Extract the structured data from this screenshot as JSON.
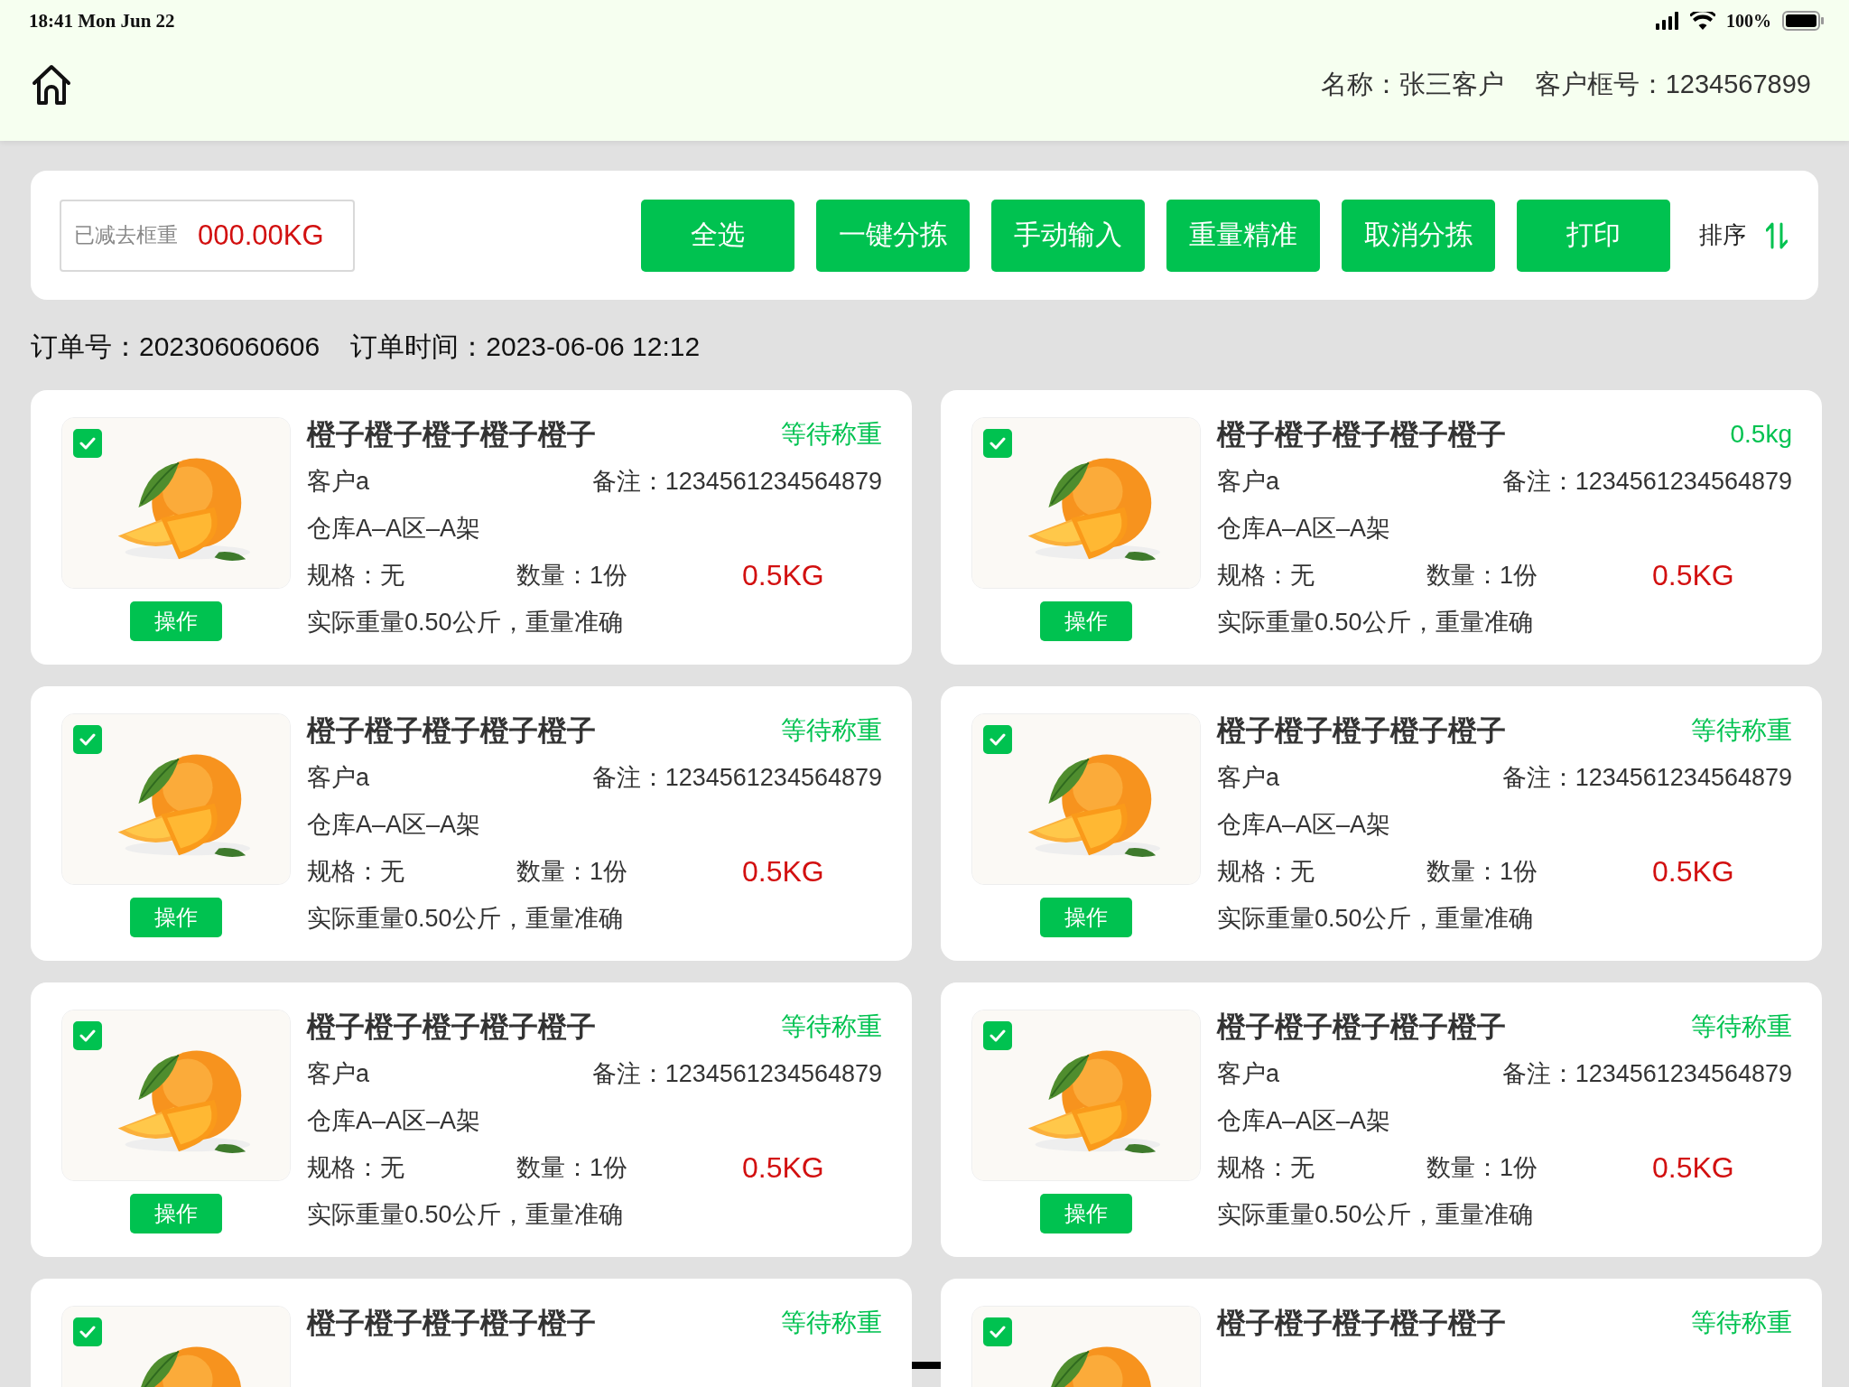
{
  "status_bar": {
    "time": "18:41 Mon Jun 22",
    "battery": "100%"
  },
  "header": {
    "name": "名称：张三客户",
    "box_no": "客户框号：1234567899"
  },
  "toolbar": {
    "tare_label": "已减去框重",
    "tare_value": "000.00KG",
    "buttons": [
      "全选",
      "一键分拣",
      "手动输入",
      "重量精准",
      "取消分拣",
      "打印"
    ],
    "sort_label": "排序"
  },
  "order": {
    "number": "订单号：202306060606",
    "time": "订单时间：2023-06-06 12:12"
  },
  "cards": [
    {
      "checked": true,
      "title": "橙子橙子橙子橙子橙子",
      "status": "等待称重",
      "customer": "客户a",
      "note": "备注：1234561234564879",
      "location": "仓库A–A区–A架",
      "spec": "规格：无",
      "qty": "数量：1份",
      "weight": "0.5KG",
      "actual": "实际重量0.50公斤，重量准确",
      "action": "操作"
    },
    {
      "checked": true,
      "title": "橙子橙子橙子橙子橙子",
      "status": "0.5kg",
      "customer": "客户a",
      "note": "备注：1234561234564879",
      "location": "仓库A–A区–A架",
      "spec": "规格：无",
      "qty": "数量：1份",
      "weight": "0.5KG",
      "actual": "实际重量0.50公斤，重量准确",
      "action": "操作"
    },
    {
      "checked": true,
      "title": "橙子橙子橙子橙子橙子",
      "status": "等待称重",
      "customer": "客户a",
      "note": "备注：1234561234564879",
      "location": "仓库A–A区–A架",
      "spec": "规格：无",
      "qty": "数量：1份",
      "weight": "0.5KG",
      "actual": "实际重量0.50公斤，重量准确",
      "action": "操作"
    },
    {
      "checked": true,
      "title": "橙子橙子橙子橙子橙子",
      "status": "等待称重",
      "customer": "客户a",
      "note": "备注：1234561234564879",
      "location": "仓库A–A区–A架",
      "spec": "规格：无",
      "qty": "数量：1份",
      "weight": "0.5KG",
      "actual": "实际重量0.50公斤，重量准确",
      "action": "操作"
    },
    {
      "checked": true,
      "title": "橙子橙子橙子橙子橙子",
      "status": "等待称重",
      "customer": "客户a",
      "note": "备注：1234561234564879",
      "location": "仓库A–A区–A架",
      "spec": "规格：无",
      "qty": "数量：1份",
      "weight": "0.5KG",
      "actual": "实际重量0.50公斤，重量准确",
      "action": "操作"
    },
    {
      "checked": true,
      "title": "橙子橙子橙子橙子橙子",
      "status": "等待称重",
      "customer": "客户a",
      "note": "备注：1234561234564879",
      "location": "仓库A–A区–A架",
      "spec": "规格：无",
      "qty": "数量：1份",
      "weight": "0.5KG",
      "actual": "实际重量0.50公斤，重量准确",
      "action": "操作"
    },
    {
      "checked": true,
      "title": "橙子橙子橙子橙子橙子",
      "status": "等待称重"
    },
    {
      "checked": true,
      "title": "橙子橙子橙子橙子橙子",
      "status": "等待称重"
    }
  ]
}
